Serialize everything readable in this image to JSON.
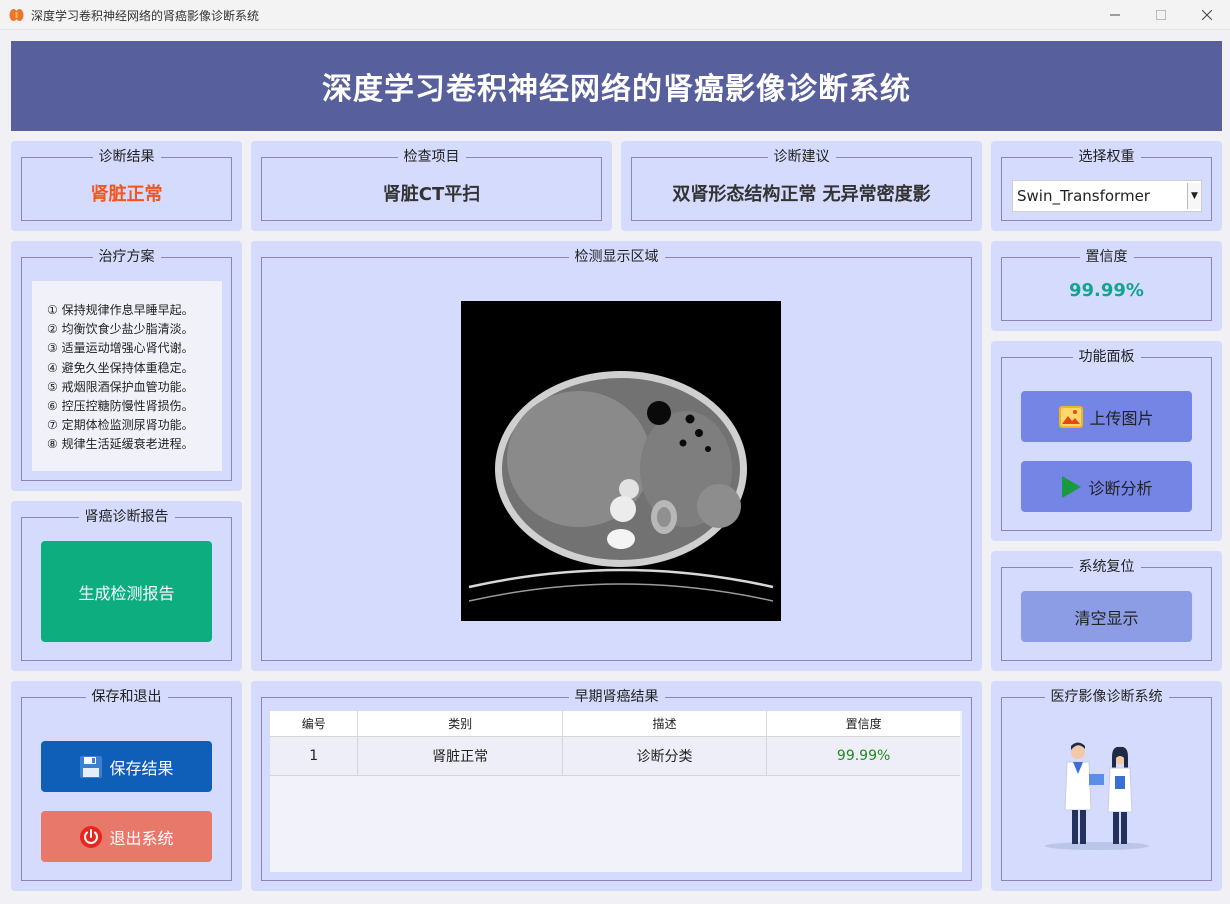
{
  "window": {
    "title": "深度学习卷积神经网络的肾癌影像诊断系统"
  },
  "header": {
    "title": "深度学习卷积神经网络的肾癌影像诊断系统"
  },
  "result": {
    "title": "诊断结果",
    "value": "肾脏正常",
    "color": "#f7531b"
  },
  "exam": {
    "title": "检查项目",
    "value": "肾脏CT平扫"
  },
  "advice": {
    "title": "诊断建议",
    "value": "双肾形态结构正常 无异常密度影"
  },
  "weights": {
    "title": "选择权重",
    "selected": "Swin_Transformer"
  },
  "treatment": {
    "title": "治疗方案",
    "items": [
      "① 保持规律作息早睡早起。",
      "② 均衡饮食少盐少脂清淡。",
      "③ 适量运动增强心肾代谢。",
      "④ 避免久坐保持体重稳定。",
      "⑤ 戒烟限酒保护血管功能。",
      "⑥ 控压控糖防慢性肾损伤。",
      "⑦ 定期体检监测尿肾功能。",
      "⑧ 规律生活延缓衰老进程。"
    ]
  },
  "display": {
    "title": "检测显示区域"
  },
  "confidence": {
    "title": "置信度",
    "value": "99.99%",
    "color": "#14a38c"
  },
  "functions": {
    "title": "功能面板",
    "upload_label": "上传图片",
    "diagnose_label": "诊断分析"
  },
  "reset": {
    "title": "系统复位",
    "clear_label": "清空显示"
  },
  "report": {
    "title": "肾癌诊断报告",
    "generate_label": "生成检测报告"
  },
  "exit_panel": {
    "title": "保存和退出",
    "save_label": "保存结果",
    "exit_label": "退出系统"
  },
  "results_table": {
    "title": "早期肾癌结果",
    "columns": [
      "编号",
      "类别",
      "描述",
      "置信度"
    ],
    "rows": [
      {
        "id": "1",
        "category": "肾脏正常",
        "description": "诊断分类",
        "confidence": "99.99%"
      }
    ]
  },
  "branding": {
    "title": "医疗影像诊断系统"
  },
  "colors": {
    "header_bg": "#575f9d",
    "panel_bg": "#d5dbfc",
    "function_button": "#7585e5",
    "clear_button": "#8c9ce5",
    "report_button": "#0dad80",
    "save_button": "#0f5eb8",
    "exit_button": "#e8786a",
    "table_confidence": "#1e8c1e"
  },
  "icons": {
    "app": "kidney-icon",
    "upload": "image-icon",
    "diagnose": "play-icon",
    "save": "floppy-disk-icon",
    "exit": "power-icon",
    "branding": "doctors-illustration"
  }
}
